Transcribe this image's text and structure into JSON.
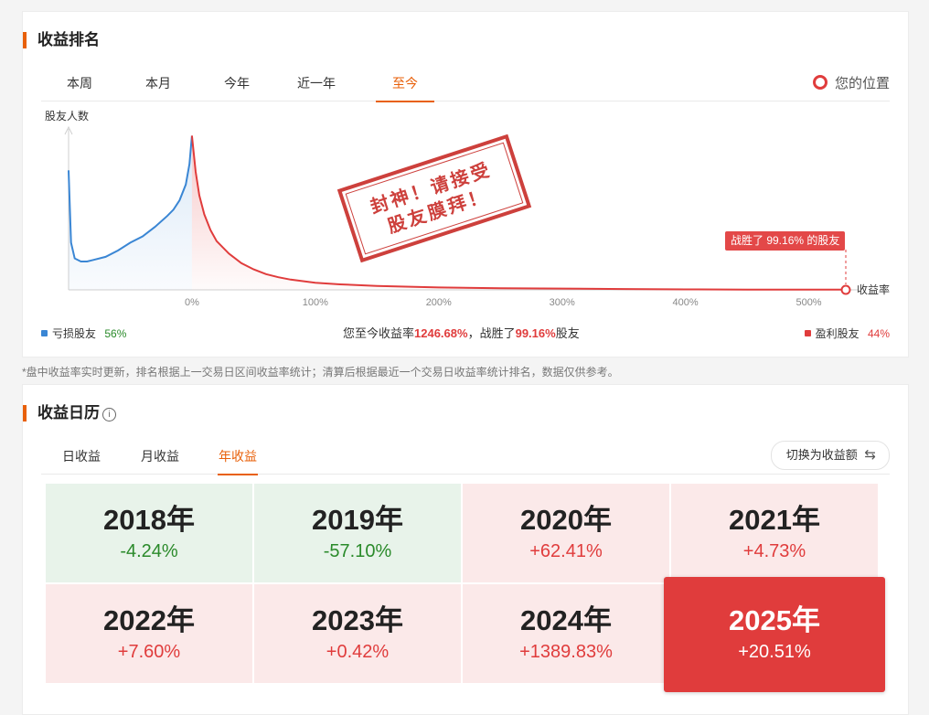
{
  "ranking": {
    "title": "收益排名",
    "tabs": [
      "本周",
      "本月",
      "今年",
      "近一年",
      "至今"
    ],
    "active_tab": 4,
    "position_legend": "您的位置",
    "stamp_line1": "封神！请接受",
    "stamp_line2": "股友膜拜！",
    "tooltip": "战胜了 99.16% 的股友",
    "footer": {
      "loss_label": "亏损股友",
      "loss_pct": "56%",
      "summary_prefix": "您至今收益率",
      "summary_rate": "1246.68%",
      "summary_mid": "，战胜了",
      "summary_beat": "99.16%",
      "summary_suffix": "股友",
      "profit_label": "盈利股友",
      "profit_pct": "44%"
    },
    "colors": {
      "loss": "#3a86d4",
      "profit": "#e03c3c",
      "accent": "#e8600a"
    }
  },
  "chart_data": {
    "type": "area",
    "ylabel": "股友人数",
    "xlabel": "收益率",
    "x_ticks": [
      "0%",
      "100%",
      "200%",
      "300%",
      "400%",
      "500%"
    ],
    "x_tick_values": [
      0,
      100,
      200,
      300,
      400,
      500
    ],
    "xlim": [
      -100,
      530
    ],
    "ylim": [
      0,
      100
    ],
    "grid": false,
    "series": [
      {
        "name": "亏损股友",
        "color": "#3a86d4",
        "x": [
          -100,
          -98,
          -95,
          -90,
          -85,
          -80,
          -70,
          -60,
          -50,
          -40,
          -30,
          -20,
          -15,
          -10,
          -5,
          -2,
          0
        ],
        "y": [
          76,
          30,
          20,
          18,
          18,
          19,
          21,
          25,
          30,
          34,
          40,
          47,
          51,
          57,
          67,
          80,
          98
        ]
      },
      {
        "name": "盈利股友",
        "color": "#e03c3c",
        "x": [
          0,
          3,
          6,
          10,
          15,
          20,
          30,
          40,
          50,
          60,
          70,
          80,
          100,
          120,
          150,
          200,
          250,
          300,
          350,
          400,
          450,
          500,
          530
        ],
        "y": [
          98,
          75,
          60,
          48,
          38,
          31,
          23,
          17,
          13,
          10,
          8,
          6.5,
          4.5,
          3.5,
          2.5,
          1.5,
          1,
          0.8,
          0.5,
          0.3,
          0.2,
          0.15,
          0.1
        ]
      }
    ],
    "marker": {
      "label": "您的位置",
      "x": 1246.68,
      "display_x": 530,
      "text": "战胜了 99.16% 的股友"
    }
  },
  "note": "*盘中收益率实时更新，排名根据上一交易日区间收益率统计；清算后根据最近一个交易日收益率统计排名，数据仅供参考。",
  "calendar": {
    "title": "收益日历",
    "info_icon": "ⓘ",
    "tabs": [
      "日收益",
      "月收益",
      "年收益"
    ],
    "active_tab": 2,
    "switch_label": "切换为收益额",
    "switch_icon": "⇆",
    "years": [
      {
        "year": "2018年",
        "pct": "-4.24%",
        "trend": "neg"
      },
      {
        "year": "2019年",
        "pct": "-57.10%",
        "trend": "neg"
      },
      {
        "year": "2020年",
        "pct": "+62.41%",
        "trend": "pos"
      },
      {
        "year": "2021年",
        "pct": "+4.73%",
        "trend": "pos"
      },
      {
        "year": "2022年",
        "pct": "+7.60%",
        "trend": "pos"
      },
      {
        "year": "2023年",
        "pct": "+0.42%",
        "trend": "pos"
      },
      {
        "year": "2024年",
        "pct": "+1389.83%",
        "trend": "pos"
      },
      {
        "year": "2025年",
        "pct": "+20.51%",
        "trend": "pos",
        "selected": true
      }
    ]
  }
}
